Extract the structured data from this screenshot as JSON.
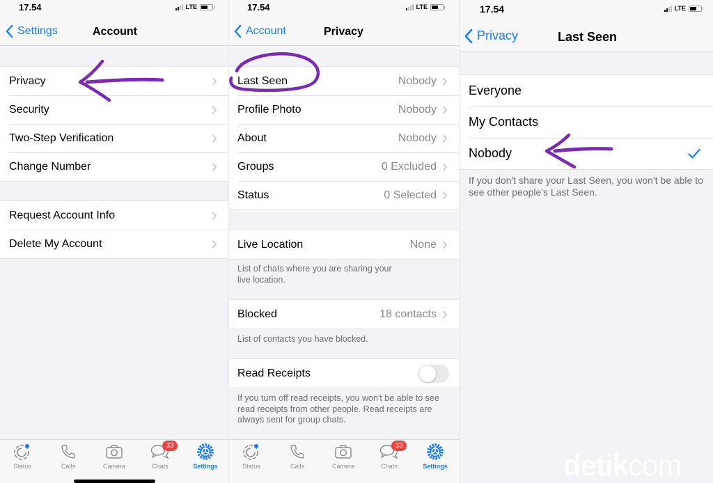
{
  "colors": {
    "accent": "#1a7ef2",
    "background": "#f2f2f7",
    "badge": "#f0423c",
    "annotation": "#7a2bb0",
    "secondary_text": "#8a8a8e"
  },
  "status_bar": {
    "time": "17.54",
    "network": "LTE"
  },
  "screens": {
    "account": {
      "back_label": "Settings",
      "title": "Account",
      "group1": [
        {
          "label": "Privacy"
        },
        {
          "label": "Security"
        },
        {
          "label": "Two-Step Verification"
        },
        {
          "label": "Change Number"
        }
      ],
      "group2": [
        {
          "label": "Request Account Info"
        },
        {
          "label": "Delete My Account"
        }
      ]
    },
    "privacy": {
      "back_label": "Account",
      "title": "Privacy",
      "group1": [
        {
          "label": "Last Seen",
          "value": "Nobody"
        },
        {
          "label": "Profile Photo",
          "value": "Nobody"
        },
        {
          "label": "About",
          "value": "Nobody"
        },
        {
          "label": "Groups",
          "value": "0 Excluded"
        },
        {
          "label": "Status",
          "value": "0 Selected"
        }
      ],
      "live_location": {
        "label": "Live Location",
        "value": "None",
        "footnote": "List of chats where you are sharing your live location."
      },
      "blocked": {
        "label": "Blocked",
        "value": "18 contacts",
        "footnote": "List of contacts you have blocked."
      },
      "read_receipts": {
        "label": "Read Receipts",
        "enabled": false,
        "footnote": "If you turn off read receipts, you won't be able to see read receipts from other people. Read receipts are always sent for group chats."
      }
    },
    "last_seen": {
      "back_label": "Privacy",
      "title": "Last Seen",
      "options": [
        {
          "label": "Everyone",
          "selected": false
        },
        {
          "label": "My Contacts",
          "selected": false
        },
        {
          "label": "Nobody",
          "selected": true
        }
      ],
      "footnote": "If you don't share your Last Seen, you won't be able to see other people's Last Seen."
    }
  },
  "tab_bar": {
    "tabs": [
      {
        "label": "Status",
        "icon": "status-icon"
      },
      {
        "label": "Calls",
        "icon": "phone-icon"
      },
      {
        "label": "Camera",
        "icon": "camera-icon"
      },
      {
        "label": "Chats",
        "icon": "chat-bubbles-icon",
        "badge": "33"
      },
      {
        "label": "Settings",
        "icon": "gear-icon",
        "active": true
      }
    ]
  },
  "watermark": {
    "bold": "detik",
    "light": "com"
  }
}
